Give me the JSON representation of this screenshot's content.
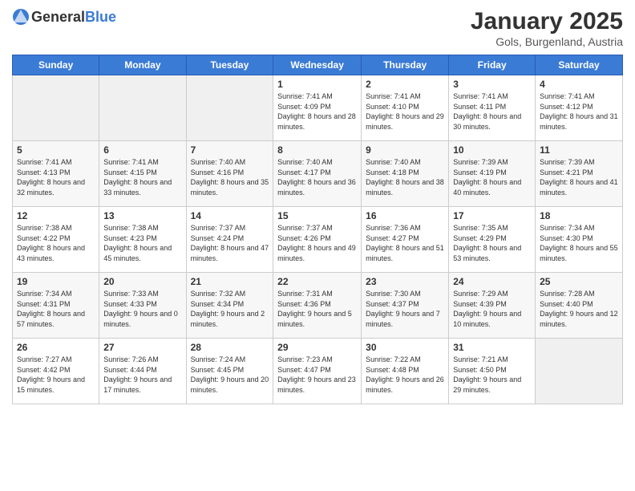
{
  "logo": {
    "text_general": "General",
    "text_blue": "Blue"
  },
  "title": "January 2025",
  "subtitle": "Gols, Burgenland, Austria",
  "days_of_week": [
    "Sunday",
    "Monday",
    "Tuesday",
    "Wednesday",
    "Thursday",
    "Friday",
    "Saturday"
  ],
  "weeks": [
    [
      {
        "day": "",
        "info": ""
      },
      {
        "day": "",
        "info": ""
      },
      {
        "day": "",
        "info": ""
      },
      {
        "day": "1",
        "info": "Sunrise: 7:41 AM\nSunset: 4:09 PM\nDaylight: 8 hours and 28 minutes."
      },
      {
        "day": "2",
        "info": "Sunrise: 7:41 AM\nSunset: 4:10 PM\nDaylight: 8 hours and 29 minutes."
      },
      {
        "day": "3",
        "info": "Sunrise: 7:41 AM\nSunset: 4:11 PM\nDaylight: 8 hours and 30 minutes."
      },
      {
        "day": "4",
        "info": "Sunrise: 7:41 AM\nSunset: 4:12 PM\nDaylight: 8 hours and 31 minutes."
      }
    ],
    [
      {
        "day": "5",
        "info": "Sunrise: 7:41 AM\nSunset: 4:13 PM\nDaylight: 8 hours and 32 minutes."
      },
      {
        "day": "6",
        "info": "Sunrise: 7:41 AM\nSunset: 4:15 PM\nDaylight: 8 hours and 33 minutes."
      },
      {
        "day": "7",
        "info": "Sunrise: 7:40 AM\nSunset: 4:16 PM\nDaylight: 8 hours and 35 minutes."
      },
      {
        "day": "8",
        "info": "Sunrise: 7:40 AM\nSunset: 4:17 PM\nDaylight: 8 hours and 36 minutes."
      },
      {
        "day": "9",
        "info": "Sunrise: 7:40 AM\nSunset: 4:18 PM\nDaylight: 8 hours and 38 minutes."
      },
      {
        "day": "10",
        "info": "Sunrise: 7:39 AM\nSunset: 4:19 PM\nDaylight: 8 hours and 40 minutes."
      },
      {
        "day": "11",
        "info": "Sunrise: 7:39 AM\nSunset: 4:21 PM\nDaylight: 8 hours and 41 minutes."
      }
    ],
    [
      {
        "day": "12",
        "info": "Sunrise: 7:38 AM\nSunset: 4:22 PM\nDaylight: 8 hours and 43 minutes."
      },
      {
        "day": "13",
        "info": "Sunrise: 7:38 AM\nSunset: 4:23 PM\nDaylight: 8 hours and 45 minutes."
      },
      {
        "day": "14",
        "info": "Sunrise: 7:37 AM\nSunset: 4:24 PM\nDaylight: 8 hours and 47 minutes."
      },
      {
        "day": "15",
        "info": "Sunrise: 7:37 AM\nSunset: 4:26 PM\nDaylight: 8 hours and 49 minutes."
      },
      {
        "day": "16",
        "info": "Sunrise: 7:36 AM\nSunset: 4:27 PM\nDaylight: 8 hours and 51 minutes."
      },
      {
        "day": "17",
        "info": "Sunrise: 7:35 AM\nSunset: 4:29 PM\nDaylight: 8 hours and 53 minutes."
      },
      {
        "day": "18",
        "info": "Sunrise: 7:34 AM\nSunset: 4:30 PM\nDaylight: 8 hours and 55 minutes."
      }
    ],
    [
      {
        "day": "19",
        "info": "Sunrise: 7:34 AM\nSunset: 4:31 PM\nDaylight: 8 hours and 57 minutes."
      },
      {
        "day": "20",
        "info": "Sunrise: 7:33 AM\nSunset: 4:33 PM\nDaylight: 9 hours and 0 minutes."
      },
      {
        "day": "21",
        "info": "Sunrise: 7:32 AM\nSunset: 4:34 PM\nDaylight: 9 hours and 2 minutes."
      },
      {
        "day": "22",
        "info": "Sunrise: 7:31 AM\nSunset: 4:36 PM\nDaylight: 9 hours and 5 minutes."
      },
      {
        "day": "23",
        "info": "Sunrise: 7:30 AM\nSunset: 4:37 PM\nDaylight: 9 hours and 7 minutes."
      },
      {
        "day": "24",
        "info": "Sunrise: 7:29 AM\nSunset: 4:39 PM\nDaylight: 9 hours and 10 minutes."
      },
      {
        "day": "25",
        "info": "Sunrise: 7:28 AM\nSunset: 4:40 PM\nDaylight: 9 hours and 12 minutes."
      }
    ],
    [
      {
        "day": "26",
        "info": "Sunrise: 7:27 AM\nSunset: 4:42 PM\nDaylight: 9 hours and 15 minutes."
      },
      {
        "day": "27",
        "info": "Sunrise: 7:26 AM\nSunset: 4:44 PM\nDaylight: 9 hours and 17 minutes."
      },
      {
        "day": "28",
        "info": "Sunrise: 7:24 AM\nSunset: 4:45 PM\nDaylight: 9 hours and 20 minutes."
      },
      {
        "day": "29",
        "info": "Sunrise: 7:23 AM\nSunset: 4:47 PM\nDaylight: 9 hours and 23 minutes."
      },
      {
        "day": "30",
        "info": "Sunrise: 7:22 AM\nSunset: 4:48 PM\nDaylight: 9 hours and 26 minutes."
      },
      {
        "day": "31",
        "info": "Sunrise: 7:21 AM\nSunset: 4:50 PM\nDaylight: 9 hours and 29 minutes."
      },
      {
        "day": "",
        "info": ""
      }
    ]
  ]
}
